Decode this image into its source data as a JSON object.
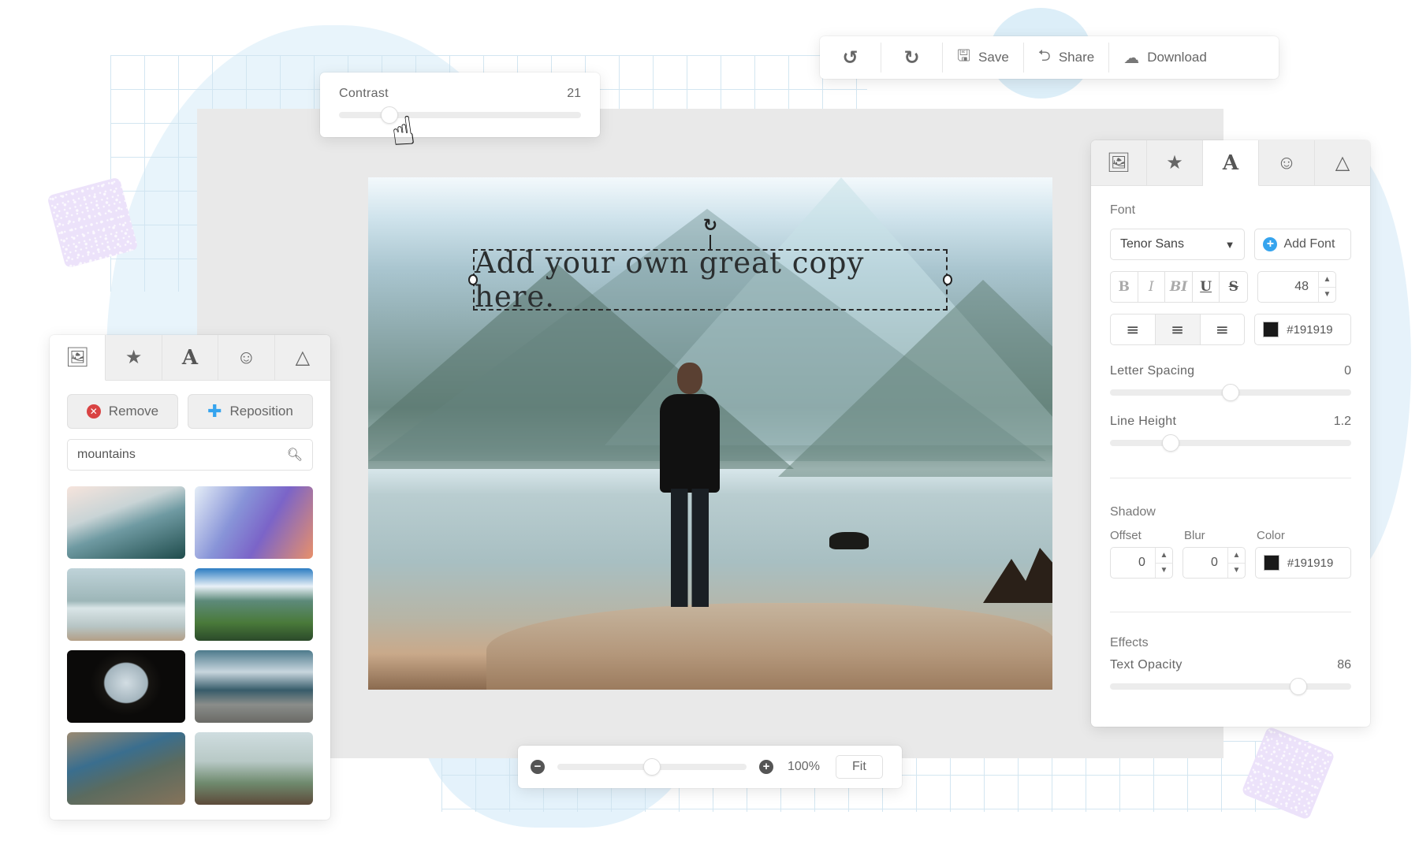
{
  "toolbar": {
    "undo_icon": "undo-icon",
    "redo_icon": "redo-icon",
    "save_label": "Save",
    "share_label": "Share",
    "download_label": "Download"
  },
  "contrast": {
    "label": "Contrast",
    "value": "21",
    "fraction": 0.21
  },
  "canvas": {
    "text": "Add your own great copy here."
  },
  "right_panel": {
    "tabs": [
      {
        "icon": "image-icon",
        "active": false
      },
      {
        "icon": "magic-wand-icon",
        "active": false
      },
      {
        "icon": "text-icon",
        "glyph": "A",
        "active": true
      },
      {
        "icon": "emoji-icon",
        "active": false
      },
      {
        "icon": "shape-triangle-icon",
        "active": false
      }
    ],
    "font_section": "Font",
    "font_name": "Tenor Sans",
    "add_font_label": "Add Font",
    "style_buttons": [
      "B",
      "I",
      "BI",
      "U",
      "S"
    ],
    "font_size": "48",
    "alignment": [
      "left",
      "center",
      "right"
    ],
    "alignment_selected": "center",
    "text_color": "#191919",
    "letter_spacing": {
      "label": "Letter Spacing",
      "value": "0",
      "fraction": 0.5
    },
    "line_height": {
      "label": "Line Height",
      "value": "1.2",
      "fraction": 0.25
    },
    "shadow": {
      "title": "Shadow",
      "offset_label": "Offset",
      "offset_value": "0",
      "blur_label": "Blur",
      "blur_value": "0",
      "color_label": "Color",
      "color_value": "#191919"
    },
    "effects": {
      "title": "Effects",
      "opacity_label": "Text Opacity",
      "opacity_value": "86",
      "fraction": 0.78
    }
  },
  "left_panel": {
    "tabs": [
      {
        "icon": "image-icon",
        "active": true
      },
      {
        "icon": "magic-wand-icon",
        "active": false
      },
      {
        "icon": "text-icon",
        "glyph": "A",
        "active": false
      },
      {
        "icon": "emoji-icon",
        "active": false
      },
      {
        "icon": "shape-triangle-icon",
        "active": false
      }
    ],
    "remove_label": "Remove",
    "reposition_label": "Reposition",
    "search_value": "mountains",
    "thumbnails": [
      "misty-forest-mountains",
      "sunset-purple-peaks",
      "man-by-lake",
      "hiker-green-valley",
      "cave-view-peaks",
      "dock-lake-reflection",
      "mountain-lake-reflection",
      "man-on-overlook"
    ]
  },
  "zoom_bar": {
    "value": "100%",
    "fraction": 0.5,
    "fit_label": "Fit"
  }
}
